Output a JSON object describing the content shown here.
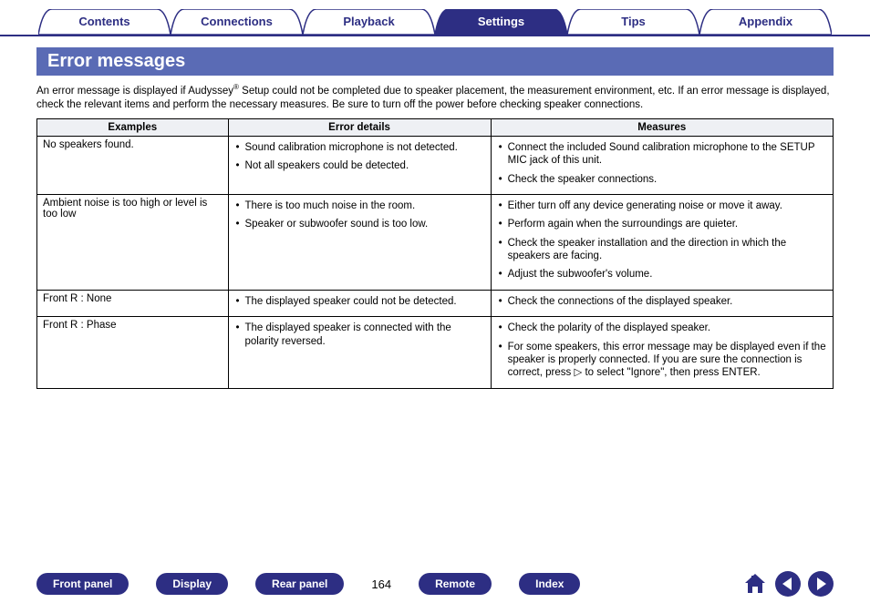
{
  "tabs": {
    "contents": "Contents",
    "connections": "Connections",
    "playback": "Playback",
    "settings": "Settings",
    "tips": "Tips",
    "appendix": "Appendix"
  },
  "section_title": "Error messages",
  "intro_part1": "An error message is displayed if Audyssey",
  "intro_reg": "®",
  "intro_part2": " Setup could not be completed due to speaker placement, the measurement environment, etc. If an error message is displayed, check the relevant items and perform the necessary measures. Be sure to turn off the power before checking speaker connections.",
  "headers": {
    "examples": "Examples",
    "details": "Error details",
    "measures": "Measures"
  },
  "rows": [
    {
      "example": "No speakers found.",
      "details": [
        "Sound calibration microphone is not detected.",
        "Not all speakers could be detected."
      ],
      "measures": [
        "Connect the included Sound calibration microphone to the SETUP MIC jack of this unit.",
        "Check the speaker connections."
      ]
    },
    {
      "example": "Ambient noise is too high or level is too low",
      "details": [
        "There is too much noise in the room.",
        "Speaker or subwoofer sound is too low."
      ],
      "measures": [
        "Either turn off any device generating noise or move it away.",
        "Perform again when the surroundings are quieter.",
        "Check the speaker installation and the direction in which the speakers are facing.",
        "Adjust the subwoofer's volume."
      ]
    },
    {
      "example": "Front R : None",
      "details": [
        "The displayed speaker could not be detected."
      ],
      "measures": [
        "Check the connections of the displayed speaker."
      ]
    },
    {
      "example": "Front R : Phase",
      "details": [
        "The displayed speaker is connected with the polarity reversed."
      ],
      "measures": [
        "Check the polarity of the displayed speaker.",
        "For some speakers, this error message may be displayed even if the speaker is properly connected. If you are sure the connection is correct, press ▷ to select \"Ignore\", then press ENTER."
      ]
    }
  ],
  "bottom": {
    "front_panel": "Front panel",
    "display": "Display",
    "rear_panel": "Rear panel",
    "page": "164",
    "remote": "Remote",
    "index": "Index"
  }
}
